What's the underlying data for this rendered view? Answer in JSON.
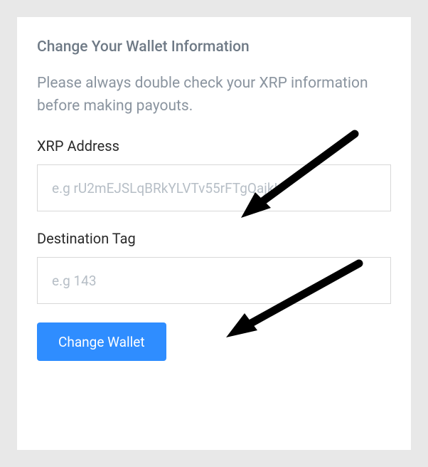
{
  "title": "Change Your Wallet Information",
  "description": "Please always double check your XRP information before making payouts.",
  "fields": {
    "xrpAddress": {
      "label": "XRP Address",
      "placeholder": "e.g rU2mEJSLqBRkYLVTv55rFTgQajkL"
    },
    "destinationTag": {
      "label": "Destination Tag",
      "placeholder": "e.g 143"
    }
  },
  "button": {
    "label": "Change Wallet"
  }
}
